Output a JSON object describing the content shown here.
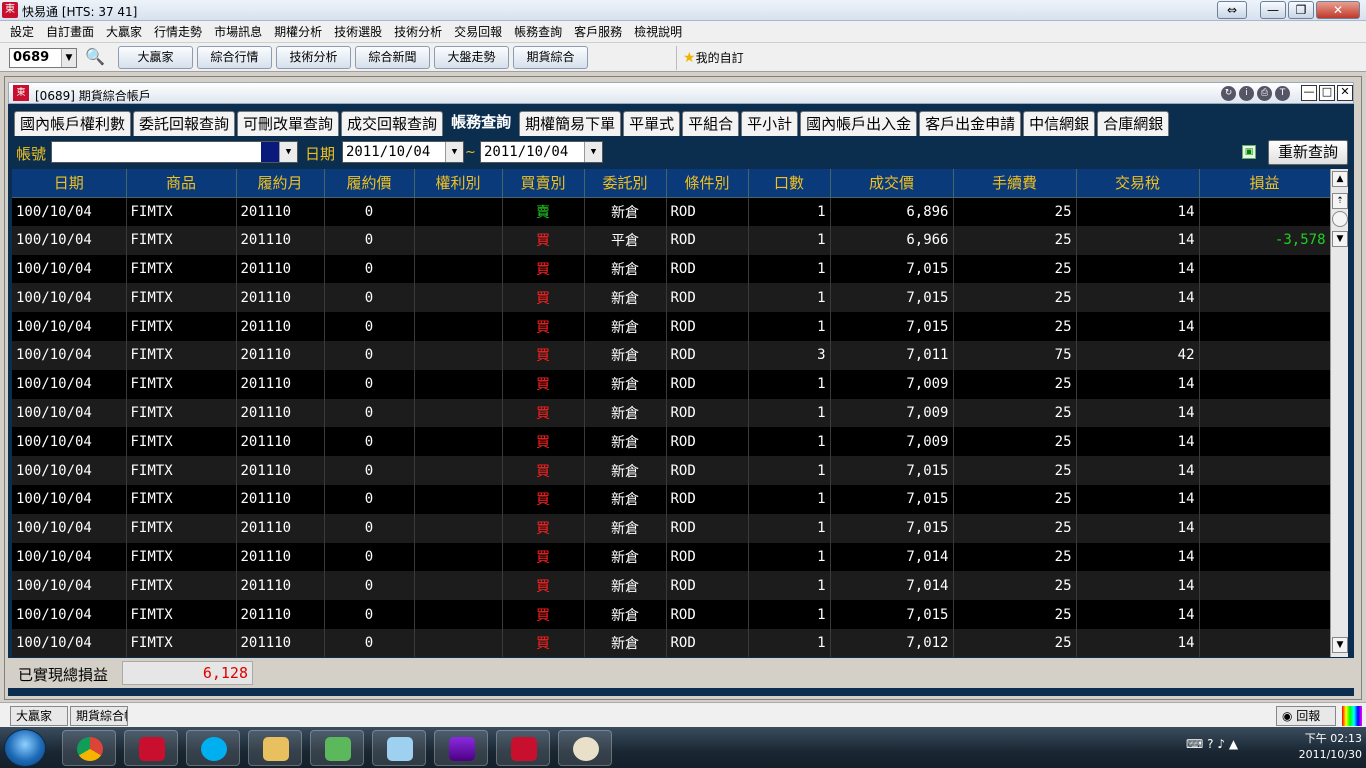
{
  "app": {
    "title": "快易通 [HTS: 37 41]",
    "logo": "東"
  },
  "window_buttons": [
    "⇔",
    "—",
    "❐",
    "✕"
  ],
  "menu": [
    "設定",
    "自訂畫面",
    "大贏家",
    "行情走勢",
    "市場訊息",
    "期權分析",
    "技術選股",
    "技術分析",
    "交易回報",
    "帳務查詢",
    "客戶服務",
    "檢視說明"
  ],
  "toolbar": {
    "code": "0689",
    "buttons": [
      "大贏家",
      "綜合行情",
      "技術分析",
      "綜合新聞",
      "大盤走勢",
      "期貨綜合"
    ],
    "favorites": "我的自訂"
  },
  "child": {
    "title": "[0689] 期貨綜合帳戶",
    "logo": "東"
  },
  "tabs": [
    "國內帳戶權利數",
    "委託回報查詢",
    "可刪改單查詢",
    "成交回報查詢",
    "帳務查詢",
    "期權簡易下單",
    "平單式",
    "平組合",
    "平小計",
    "國內帳戶出入金",
    "客戶出金申請",
    "中信網銀",
    "合庫網銀"
  ],
  "active_tab": 4,
  "filter": {
    "account_label": "帳號",
    "account_value": "",
    "date_label": "日期",
    "date_from": "2011/10/04",
    "date_to": "2011/10/04",
    "tilde": "~",
    "requery": "重新查詢"
  },
  "columns": [
    "日期",
    "商品",
    "履約月",
    "履約價",
    "權利別",
    "買賣別",
    "委託別",
    "條件別",
    "口數",
    "成交價",
    "手續費",
    "交易稅",
    "損益"
  ],
  "rows": [
    [
      "100/10/04",
      "FIMTX",
      "201110",
      "0",
      "",
      "賣",
      "新倉",
      "ROD",
      "1",
      "6,896",
      "25",
      "14",
      ""
    ],
    [
      "100/10/04",
      "FIMTX",
      "201110",
      "0",
      "",
      "買",
      "平倉",
      "ROD",
      "1",
      "6,966",
      "25",
      "14",
      "-3,578"
    ],
    [
      "100/10/04",
      "FIMTX",
      "201110",
      "0",
      "",
      "買",
      "新倉",
      "ROD",
      "1",
      "7,015",
      "25",
      "14",
      ""
    ],
    [
      "100/10/04",
      "FIMTX",
      "201110",
      "0",
      "",
      "買",
      "新倉",
      "ROD",
      "1",
      "7,015",
      "25",
      "14",
      ""
    ],
    [
      "100/10/04",
      "FIMTX",
      "201110",
      "0",
      "",
      "買",
      "新倉",
      "ROD",
      "1",
      "7,015",
      "25",
      "14",
      ""
    ],
    [
      "100/10/04",
      "FIMTX",
      "201110",
      "0",
      "",
      "買",
      "新倉",
      "ROD",
      "3",
      "7,011",
      "75",
      "42",
      ""
    ],
    [
      "100/10/04",
      "FIMTX",
      "201110",
      "0",
      "",
      "買",
      "新倉",
      "ROD",
      "1",
      "7,009",
      "25",
      "14",
      ""
    ],
    [
      "100/10/04",
      "FIMTX",
      "201110",
      "0",
      "",
      "買",
      "新倉",
      "ROD",
      "1",
      "7,009",
      "25",
      "14",
      ""
    ],
    [
      "100/10/04",
      "FIMTX",
      "201110",
      "0",
      "",
      "買",
      "新倉",
      "ROD",
      "1",
      "7,009",
      "25",
      "14",
      ""
    ],
    [
      "100/10/04",
      "FIMTX",
      "201110",
      "0",
      "",
      "買",
      "新倉",
      "ROD",
      "1",
      "7,015",
      "25",
      "14",
      ""
    ],
    [
      "100/10/04",
      "FIMTX",
      "201110",
      "0",
      "",
      "買",
      "新倉",
      "ROD",
      "1",
      "7,015",
      "25",
      "14",
      ""
    ],
    [
      "100/10/04",
      "FIMTX",
      "201110",
      "0",
      "",
      "買",
      "新倉",
      "ROD",
      "1",
      "7,015",
      "25",
      "14",
      ""
    ],
    [
      "100/10/04",
      "FIMTX",
      "201110",
      "0",
      "",
      "買",
      "新倉",
      "ROD",
      "1",
      "7,014",
      "25",
      "14",
      ""
    ],
    [
      "100/10/04",
      "FIMTX",
      "201110",
      "0",
      "",
      "買",
      "新倉",
      "ROD",
      "1",
      "7,014",
      "25",
      "14",
      ""
    ],
    [
      "100/10/04",
      "FIMTX",
      "201110",
      "0",
      "",
      "買",
      "新倉",
      "ROD",
      "1",
      "7,015",
      "25",
      "14",
      ""
    ],
    [
      "100/10/04",
      "FIMTX",
      "201110",
      "0",
      "",
      "買",
      "新倉",
      "ROD",
      "1",
      "7,012",
      "25",
      "14",
      ""
    ]
  ],
  "total": {
    "label": "已實現總損益",
    "value": "6,128"
  },
  "statusbar": {
    "items": [
      "大贏家",
      "期貨綜合帳戶"
    ],
    "report": "回報"
  },
  "taskbar": {
    "time": "下午 02:13",
    "date": "2011/10/30"
  },
  "colors": {
    "buy": "#ff2020",
    "sell": "#20d020",
    "header": "#0a3a7a",
    "header_text": "#f0c020",
    "panel": "#0b2e4e"
  },
  "icons": [
    "search-icon",
    "star-icon",
    "export-icon",
    "help-icon",
    "volume-icon",
    "flag-icon"
  ]
}
